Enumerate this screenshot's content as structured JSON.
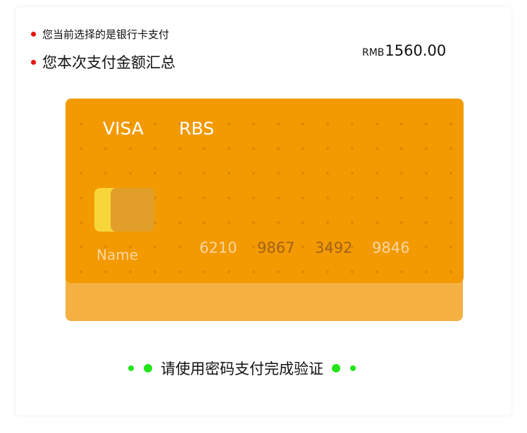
{
  "colors": {
    "bullet": "#e8140c",
    "card": "#f39a00",
    "card_back": "#f5b142",
    "chip_front": "#f8d63a",
    "chip_back": "#e29e2a",
    "card_dot": "#d88a00",
    "verify_dot": "#22e61a"
  },
  "info": {
    "line1": "您当前选择的是银行卡支付",
    "line2": "您本次支付金额汇总",
    "currency": "RMB",
    "amount": "1560.00"
  },
  "card": {
    "brand": "VISA",
    "bank": "RBS",
    "holder": "Name",
    "number_groups": [
      "6210",
      "9867",
      "3492",
      "9846"
    ]
  },
  "verify": {
    "text": "请使用密码支付完成验证"
  }
}
